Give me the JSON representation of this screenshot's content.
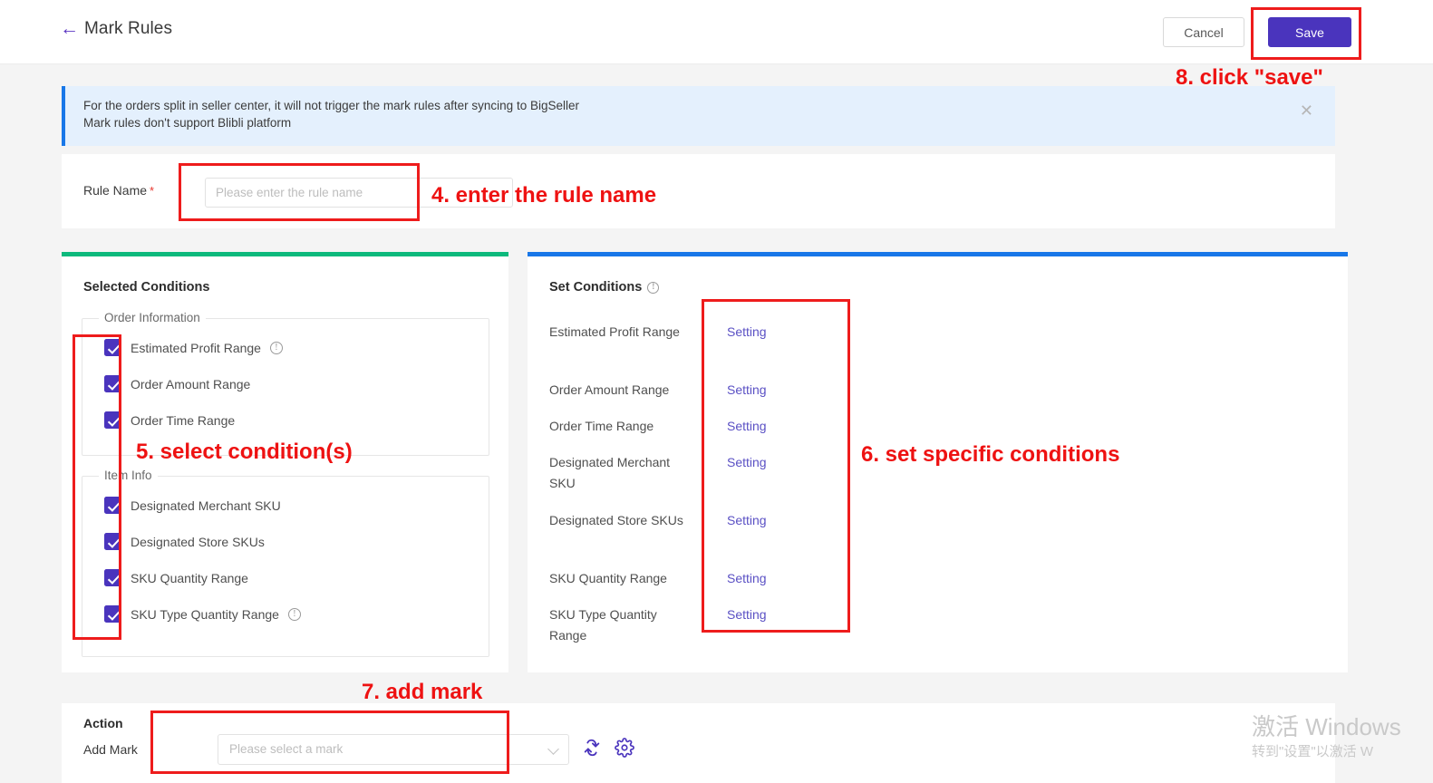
{
  "header": {
    "back_icon": "back-arrow-icon",
    "title": "Mark Rules",
    "cancel_label": "Cancel",
    "save_label": "Save"
  },
  "notice": {
    "line1": "For the orders split in seller center, it will not trigger the mark rules after syncing to BigSeller",
    "line2": "Mark rules don't support Blibli platform",
    "close_icon": "✕"
  },
  "rule": {
    "label": "Rule Name",
    "required_mark": "*",
    "placeholder": "Please enter the rule name",
    "value": ""
  },
  "selected_conditions": {
    "heading": "Selected Conditions",
    "groups": [
      {
        "legend": "Order Information",
        "items": [
          {
            "label": "Estimated Profit Range",
            "checked": true,
            "info": true
          },
          {
            "label": "Order Amount Range",
            "checked": true,
            "info": false
          },
          {
            "label": "Order Time Range",
            "checked": true,
            "info": false
          }
        ]
      },
      {
        "legend": "Item Info",
        "items": [
          {
            "label": "Designated Merchant SKU",
            "checked": true,
            "info": false
          },
          {
            "label": "Designated Store SKUs",
            "checked": true,
            "info": false
          },
          {
            "label": "SKU Quantity Range",
            "checked": true,
            "info": false
          },
          {
            "label": "SKU Type Quantity Range",
            "checked": true,
            "info": true
          }
        ]
      }
    ]
  },
  "set_conditions": {
    "heading": "Set Conditions",
    "info_icon": "!",
    "rows": [
      {
        "name": "Estimated Profit Range",
        "link": "Setting"
      },
      {
        "name": "Order Amount Range",
        "link": "Setting"
      },
      {
        "name": "Order Time Range",
        "link": "Setting"
      },
      {
        "name": "Designated Merchant SKU",
        "link": "Setting"
      },
      {
        "name": "Designated Store SKUs",
        "link": "Setting"
      },
      {
        "name": "SKU Quantity Range",
        "link": "Setting"
      },
      {
        "name": "SKU Type Quantity Range",
        "link": "Setting"
      }
    ]
  },
  "action": {
    "heading": "Action",
    "add_mark_label": "Add Mark",
    "mark_placeholder": "Please select a mark",
    "mark_value": "",
    "refresh_icon": "refresh-icon",
    "gear_icon": "gear-icon"
  },
  "annotations": {
    "step4": "4. enter the rule name",
    "step5": "5. select condition(s)",
    "step6": "6. set specific conditions",
    "step7": "7. add mark",
    "step8": "8. click \"save\"",
    "color": "#ee1212"
  },
  "watermark": {
    "line1": "激活 Windows",
    "line2": "转到\"设置\"以激活 W"
  },
  "colors": {
    "primary": "#4a34bd",
    "link": "#5a50c4",
    "green_accent": "#0cb97c",
    "blue_accent": "#1877e8",
    "notice_bg": "#e4f0fd",
    "annotation_red": "#ee1212"
  }
}
